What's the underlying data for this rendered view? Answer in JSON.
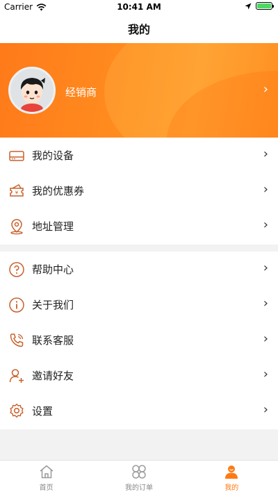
{
  "status_bar": {
    "carrier": "Carrier",
    "time": "10:41 AM"
  },
  "nav": {
    "title": "我的"
  },
  "profile": {
    "name": "经销商"
  },
  "menu_group_1": [
    {
      "label": "我的设备",
      "icon": "device-icon"
    },
    {
      "label": "我的优惠券",
      "icon": "coupon-icon"
    },
    {
      "label": "地址管理",
      "icon": "location-icon"
    }
  ],
  "menu_group_2": [
    {
      "label": "帮助中心",
      "icon": "help-icon"
    },
    {
      "label": "关于我们",
      "icon": "info-icon"
    },
    {
      "label": "联系客服",
      "icon": "phone-icon"
    },
    {
      "label": "邀请好友",
      "icon": "invite-icon"
    },
    {
      "label": "设置",
      "icon": "settings-icon"
    }
  ],
  "tabs": [
    {
      "label": "首页",
      "icon": "home-icon",
      "active": false
    },
    {
      "label": "我的订单",
      "icon": "orders-icon",
      "active": false
    },
    {
      "label": "我的",
      "icon": "profile-icon",
      "active": true
    }
  ],
  "colors": {
    "accent": "#ff7a14",
    "icon_stroke": "#c8602a"
  }
}
